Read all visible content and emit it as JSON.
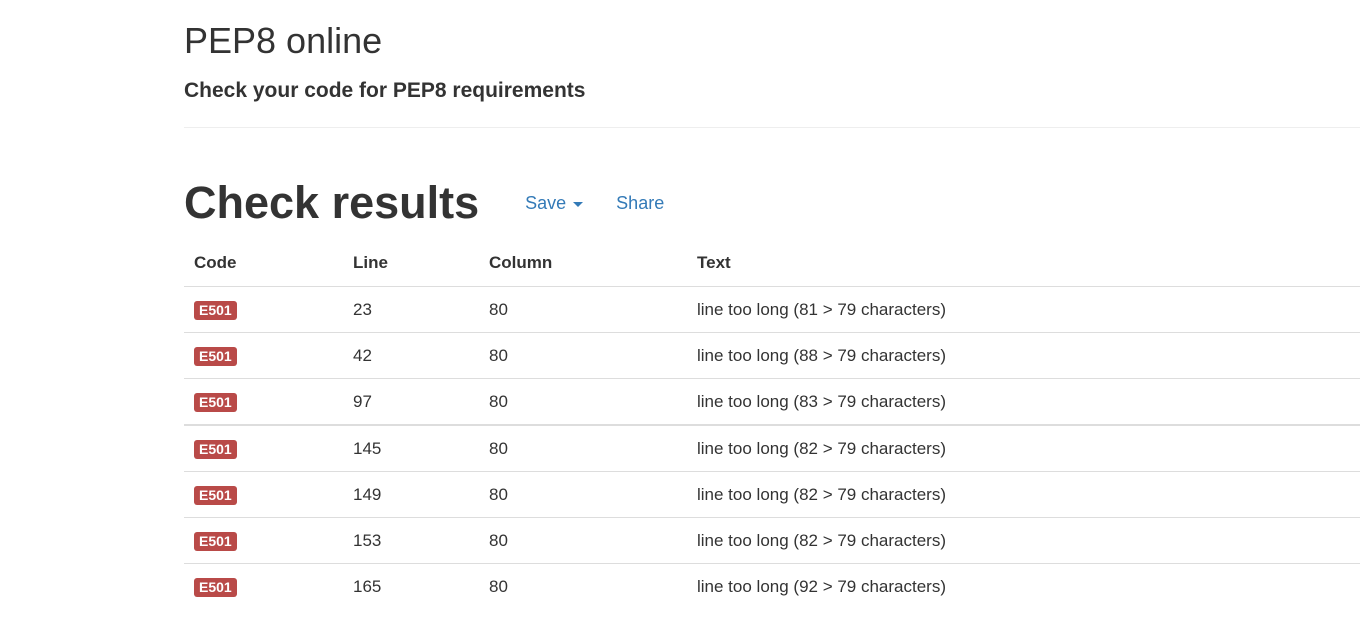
{
  "header": {
    "title": "PEP8 online",
    "subtitle": "Check your code for PEP8 requirements"
  },
  "results": {
    "title": "Check results",
    "save_label": "Save",
    "share_label": "Share",
    "columns": [
      "Code",
      "Line",
      "Column",
      "Text"
    ],
    "badge_color": "#b94a48",
    "link_color": "#337ab7",
    "rows": [
      {
        "code": "E501",
        "line": "23",
        "column": "80",
        "text": "line too long (81 > 79 characters)"
      },
      {
        "code": "E501",
        "line": "42",
        "column": "80",
        "text": "line too long (88 > 79 characters)"
      },
      {
        "code": "E501",
        "line": "97",
        "column": "80",
        "text": "line too long (83 > 79 characters)"
      },
      {
        "code": "E501",
        "line": "145",
        "column": "80",
        "text": "line too long (82 > 79 characters)"
      },
      {
        "code": "E501",
        "line": "149",
        "column": "80",
        "text": "line too long (82 > 79 characters)"
      },
      {
        "code": "E501",
        "line": "153",
        "column": "80",
        "text": "line too long (82 > 79 characters)"
      },
      {
        "code": "E501",
        "line": "165",
        "column": "80",
        "text": "line too long (92 > 79 characters)"
      }
    ]
  }
}
